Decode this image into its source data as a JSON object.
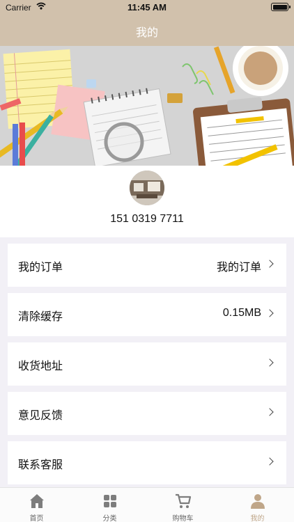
{
  "status_bar": {
    "carrier": "Carrier",
    "time": "11:45 AM"
  },
  "nav": {
    "title": "我的"
  },
  "profile": {
    "phone": "151 0319 7711"
  },
  "menu": [
    {
      "label": "我的订单",
      "value": "我的订单"
    },
    {
      "label": "清除缓存",
      "value": "0.15MB"
    },
    {
      "label": "收货地址",
      "value": ""
    },
    {
      "label": "意见反馈",
      "value": ""
    },
    {
      "label": "联系客服",
      "value": ""
    }
  ],
  "tabs": [
    {
      "label": "首页",
      "icon": "home-icon"
    },
    {
      "label": "分类",
      "icon": "grid-icon"
    },
    {
      "label": "购物车",
      "icon": "cart-icon"
    },
    {
      "label": "我的",
      "icon": "person-icon",
      "active": true
    }
  ],
  "colors": {
    "header": "#d1c1ac",
    "tab_active": "#bfa689",
    "background": "#f2f0f6"
  }
}
